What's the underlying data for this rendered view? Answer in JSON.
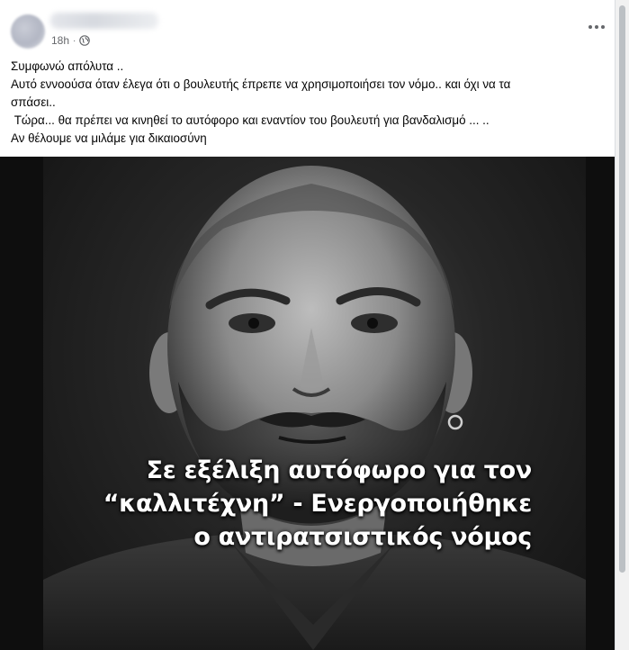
{
  "post": {
    "author": {
      "name": "",
      "avatar_icon": "user-avatar-blurred"
    },
    "timestamp": "18h",
    "separator": "·",
    "privacy_icon": "globe-icon",
    "more_icon": "more-options-icon",
    "text_lines": [
      "Συμφωνώ απόλυτα ..",
      "Αυτό εννοούσα όταν έλεγα ότι ο βουλευτής έπρεπε να χρησιμοποιήσει τον νόμο.. και όχι να τα",
      "σπάσει..",
      " Τώρα... θα πρέπει να κινηθεί το αυτόφορο και εναντίον του βουλευτή για βανδαλισμό ... ..",
      "Αν θέλουμε να μιλάμε για δικαιοσύνη"
    ],
    "image": {
      "description_icon": "portrait-photo",
      "caption_lines": [
        "Σε εξέλιξη αυτόφωρο για τον",
        "“καλλιτέχνη” - Ενεργοποιήθηκε",
        "ο αντιρατσιστικός νόμος"
      ]
    }
  },
  "colors": {
    "background": "#f0f2f5",
    "card": "#ffffff",
    "secondary_text": "#65676b",
    "primary_text": "#050505",
    "image_frame": "#0e0e0e",
    "caption_text": "#ffffff"
  }
}
